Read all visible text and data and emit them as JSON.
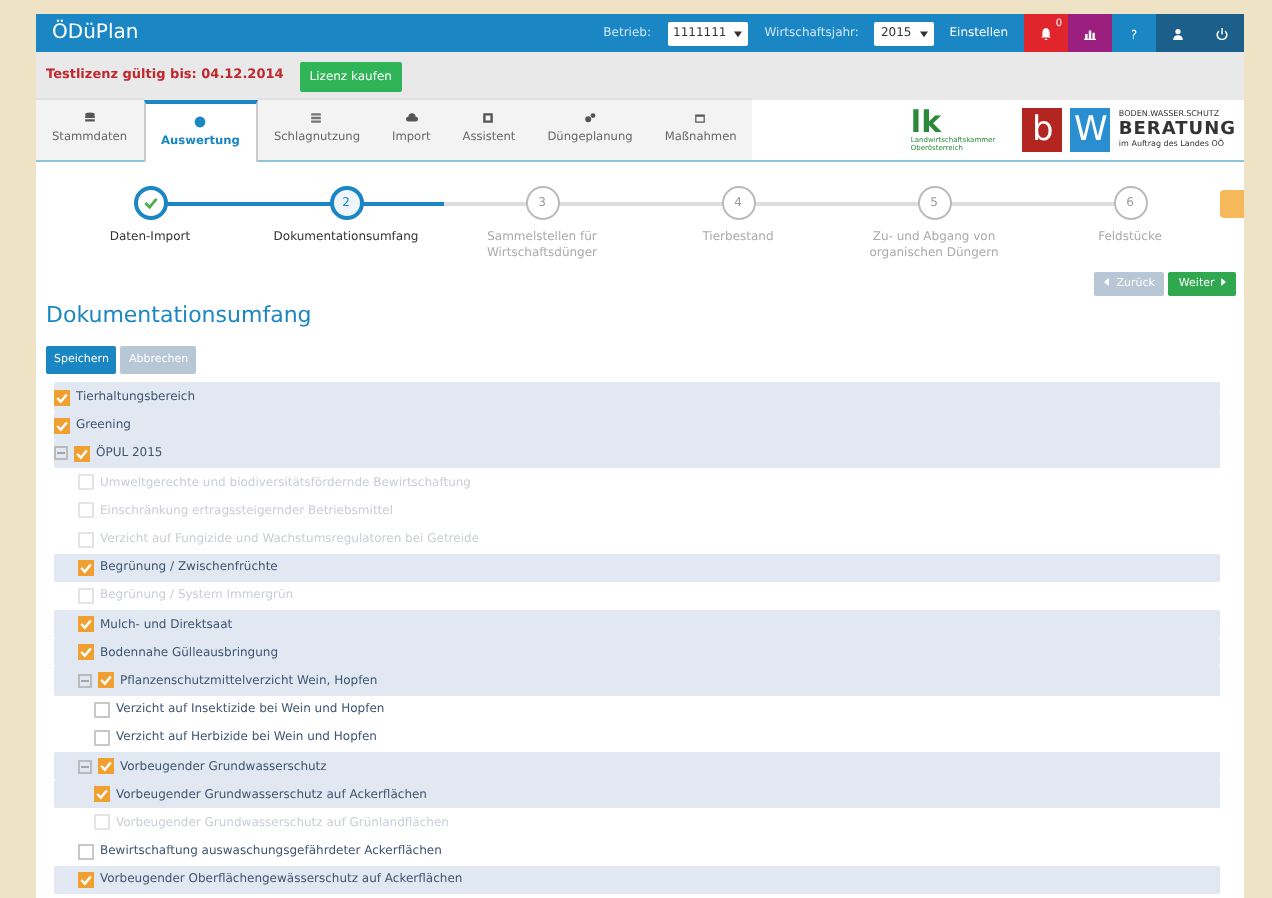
{
  "navbar": {
    "brand": "ÖDüPlan",
    "betrieb_label": "Betrieb:",
    "betrieb_value": "1111111",
    "jahr_label": "Wirtschaftsjahr:",
    "jahr_value": "2015",
    "apply_link": "Einstellen",
    "notification_count": "0"
  },
  "license": {
    "text": "Testlizenz gültig bis: 04.12.2014",
    "button": "Lizenz kaufen"
  },
  "tabs": [
    {
      "label": "Stammdaten",
      "selected": false
    },
    {
      "label": "Auswertung",
      "selected": true
    },
    {
      "label": "Schlagnutzung",
      "selected": false
    },
    {
      "label": "Import",
      "selected": false
    },
    {
      "label": "Assistent",
      "selected": false
    },
    {
      "label": "Düngeplanung",
      "selected": false
    },
    {
      "label": "Maßnahmen",
      "selected": false
    }
  ],
  "logos": {
    "lk": "lk",
    "lk_caption": "Landwirtschaftskammer Oberösterreich",
    "b": "b",
    "w": "W",
    "bw_top": "BODEN.WASSER.SCHUTZ",
    "bw_main": "BERATUNG",
    "bw_bottom": "im Auftrag des Landes OÖ"
  },
  "steps": [
    {
      "label": "Daten-Import",
      "completed": true,
      "selected": false
    },
    {
      "number": "2",
      "label": "Dokumentationsumfang",
      "completed": false,
      "selected": true
    },
    {
      "number": "3",
      "label": "Sammelstellen für Wirtschaftsdünger",
      "completed": false,
      "selected": false
    },
    {
      "number": "4",
      "label": "Tierbestand",
      "completed": false,
      "selected": false
    },
    {
      "number": "5",
      "label": "Zu- und Abgang von organischen Düngern",
      "completed": false,
      "selected": false
    },
    {
      "number": "6",
      "label": "Feldstücke",
      "completed": false,
      "selected": false
    }
  ],
  "nav_buttons": {
    "back": "Zurück",
    "back_disabled": true,
    "next": "Weiter"
  },
  "heading": "Dokumentationsumfang",
  "actions": {
    "save": "Speichern",
    "cancel": "Abbrechen",
    "cancel_disabled": true
  },
  "tree": [
    {
      "label": "Tierhaltungsbereich",
      "checked": true,
      "disabled": false
    },
    {
      "label": "Greening",
      "checked": true,
      "disabled": false
    },
    {
      "label": "ÖPUL 2015",
      "checked": true,
      "disabled": false,
      "expanded": true,
      "children": [
        {
          "label": "Umweltgerechte und biodiversitätsfördernde Bewirtschaftung",
          "checked": false,
          "disabled": true
        },
        {
          "label": "Einschränkung ertragssteigernder Betriebsmittel",
          "checked": false,
          "disabled": true
        },
        {
          "label": "Verzicht auf Fungizide und Wachstumsregulatoren bei Getreide",
          "checked": false,
          "disabled": true
        },
        {
          "label": "Begrünung / Zwischenfrüchte",
          "checked": true,
          "disabled": false
        },
        {
          "label": "Begrünung / System Immergrün",
          "checked": false,
          "disabled": true
        },
        {
          "label": "Mulch- und Direktsaat",
          "checked": true,
          "disabled": false
        },
        {
          "label": "Bodennahe Gülleausbringung",
          "checked": true,
          "disabled": false
        },
        {
          "label": "Pflanzenschutzmittelverzicht Wein, Hopfen",
          "checked": true,
          "disabled": false,
          "expanded": true,
          "children": [
            {
              "label": "Verzicht auf Insektizide bei Wein und Hopfen",
              "checked": false,
              "disabled": false
            },
            {
              "label": "Verzicht auf Herbizide bei Wein und Hopfen",
              "checked": false,
              "disabled": false
            }
          ]
        },
        {
          "label": "Vorbeugender Grundwasserschutz",
          "checked": true,
          "disabled": false,
          "expanded": true,
          "children": [
            {
              "label": "Vorbeugender Grundwasserschutz auf Ackerflächen",
              "checked": true,
              "disabled": false
            },
            {
              "label": "Vorbeugender Grundwasserschutz auf Grünlandflächen",
              "checked": false,
              "disabled": true
            }
          ]
        },
        {
          "label": "Bewirtschaftung auswaschungsgefährdeter Ackerflächen",
          "checked": false,
          "disabled": false
        },
        {
          "label": "Vorbeugender Oberflächengewässerschutz auf Ackerflächen",
          "checked": true,
          "disabled": false
        }
      ]
    }
  ]
}
